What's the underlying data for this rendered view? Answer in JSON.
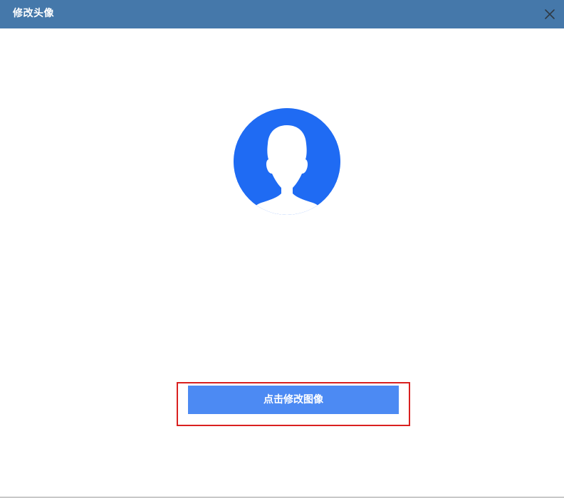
{
  "dialog": {
    "title": "修改头像",
    "close_icon": "close-icon"
  },
  "avatar": {
    "icon": "default-avatar-icon",
    "background_color": "#1f6bf3"
  },
  "actions": {
    "change_image_label": "点击修改图像",
    "button_color": "#4c8af3",
    "highlight_color": "#d9201f"
  },
  "theme": {
    "titlebar_color": "#4578aa"
  }
}
